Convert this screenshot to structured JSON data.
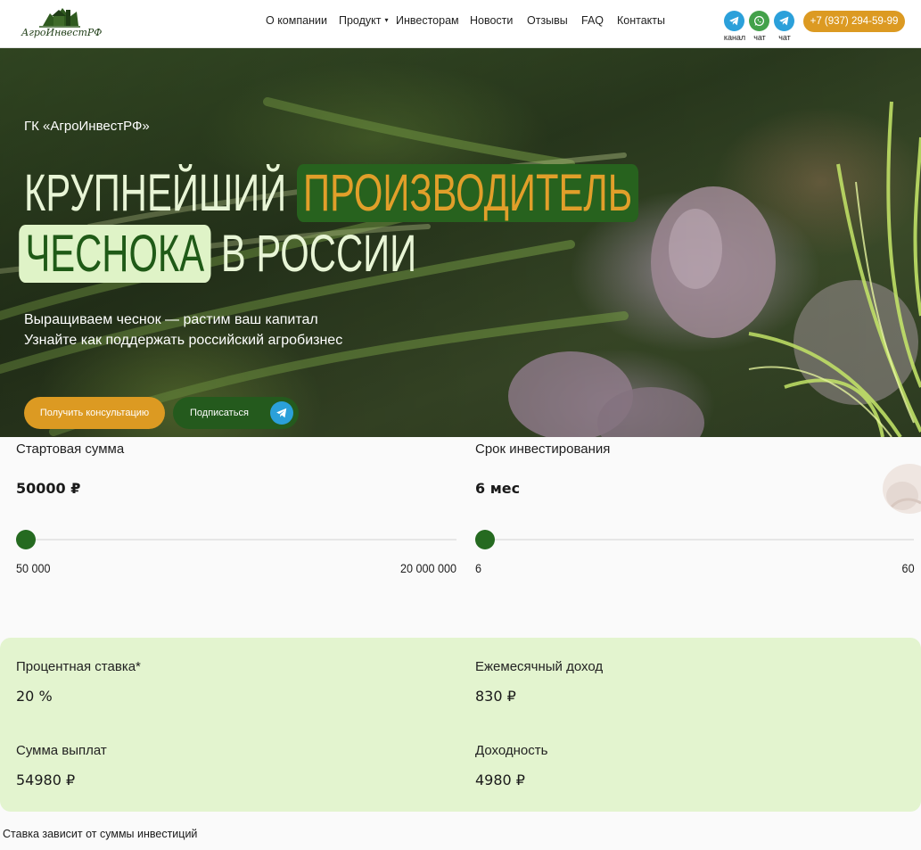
{
  "header": {
    "logo_text": "АгроИнвестРФ",
    "nav": [
      {
        "label": "О компании"
      },
      {
        "label": "Продукт",
        "dropdown": true
      },
      {
        "label": "Инвесторам"
      },
      {
        "label": "Новости"
      },
      {
        "label": "Отзывы"
      },
      {
        "label": "FAQ"
      },
      {
        "label": "Контакты"
      }
    ],
    "caret": "▾",
    "socials": [
      {
        "icon": "telegram-icon",
        "label": "канал"
      },
      {
        "icon": "whatsapp-icon",
        "label": "чат"
      },
      {
        "icon": "telegram-icon",
        "label": "чат"
      }
    ],
    "phone": "+7 (937) 294-59-99"
  },
  "hero": {
    "kicker": "ГК «АгроИнвестРФ»",
    "title_line1_plain": "КРУПНЕЙШИЙ ",
    "title_line1_highlight": "ПРОИЗВОДИТЕЛЬ",
    "title_line2_highlight": "ЧЕСНОКА",
    "title_line2_plain": " В РОССИИ",
    "subtitle_line1": "Выращиваем чеснок — растим ваш капитал",
    "subtitle_line2": "Узнайте как поддержать российский агробизнес",
    "consult_button": "Получить консультацию",
    "subscribe_button": "Подписаться"
  },
  "calculator": {
    "amount": {
      "label": "Стартовая сумма",
      "value": "50000 ₽",
      "min": "50 000",
      "max": "20 000 000",
      "position": 0
    },
    "term": {
      "label": "Срок инвестирования",
      "value": "6 мес",
      "min": "6",
      "max": "60",
      "position": 0
    },
    "results": {
      "rate": {
        "label": "Процентная ставка*",
        "value": "20 %"
      },
      "monthly": {
        "label": "Ежемесячный доход",
        "value": "830 ₽"
      },
      "payout": {
        "label": "Сумма выплат",
        "value": "54980 ₽"
      },
      "profit": {
        "label": "Доходность",
        "value": "4980 ₽"
      }
    },
    "footnote": "Ставка зависит от суммы инвестиций"
  },
  "colors": {
    "accent_orange": "#dc9a22",
    "brand_green": "#256a20",
    "light_green": "#e3f4cf",
    "telegram_blue": "#2ba0da",
    "whatsapp_green": "#43a14a"
  }
}
